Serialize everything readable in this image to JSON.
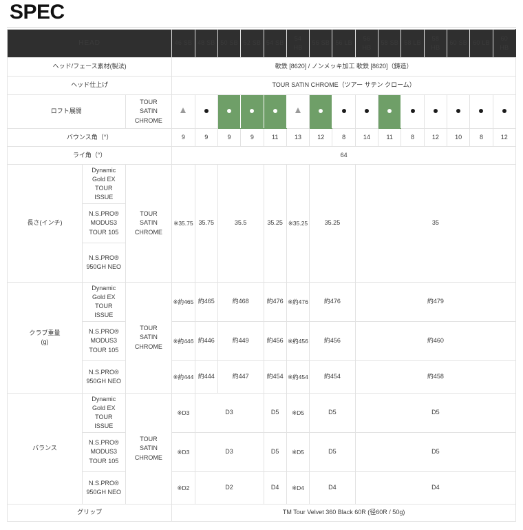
{
  "page": {
    "title": "SPEC"
  },
  "table": {
    "head_label": "HEAD",
    "columns": [
      {
        "line1": "46 SB",
        "line2": ""
      },
      {
        "line1": "48 SB",
        "line2": ""
      },
      {
        "line1": "50 SB",
        "line2": ""
      },
      {
        "line1": "52 SB",
        "line2": ""
      },
      {
        "line1": "54 SB",
        "line2": ""
      },
      {
        "line1": "54",
        "line2": "HB"
      },
      {
        "line1": "56 SB",
        "line2": ""
      },
      {
        "line1": "56 LB",
        "line2": ""
      },
      {
        "line1": "56",
        "line2": "HB"
      },
      {
        "line1": "58 SB",
        "line2": ""
      },
      {
        "line1": "58 LB",
        "line2": ""
      },
      {
        "line1": "58",
        "line2": "HB"
      },
      {
        "line1": "60 SB",
        "line2": ""
      },
      {
        "line1": "60 LB",
        "line2": ""
      },
      {
        "line1": "60",
        "line2": "HB"
      }
    ],
    "rows": {
      "material": {
        "label": "ヘッド/フェース素材(製法)",
        "value": "軟鉄 [8620] / ノンメッキ加工 軟鉄 [8620]（鋳造）"
      },
      "finish": {
        "label": "ヘッド仕上げ",
        "value": "TOUR SATIN CHROME（ツアー サテン クローム）"
      },
      "loft": {
        "label": "ロフト展開",
        "finish": "TOUR SATIN CHROME",
        "markers": [
          "triangle",
          "dot",
          "dot-green",
          "dot-green",
          "dot-green",
          "triangle",
          "dot-green",
          "dot",
          "dot",
          "dot-green",
          "dot",
          "dot",
          "dot",
          "dot",
          "dot"
        ]
      },
      "bounce": {
        "label": "バウンス角（°）",
        "values": [
          "9",
          "9",
          "9",
          "9",
          "11",
          "13",
          "12",
          "8",
          "14",
          "11",
          "8",
          "12",
          "10",
          "8",
          "12"
        ]
      },
      "lie": {
        "label": "ライ角（°）",
        "value": "64"
      },
      "length": {
        "label": "長さ(インチ)",
        "finish": "TOUR SATIN CHROME",
        "shafts": [
          "Dynamic Gold EX TOUR ISSUE",
          "N.S.PRO® MODUS3 TOUR 105",
          "N.S.PRO® 950GH NEO"
        ],
        "cells": [
          {
            "text": "※35.75",
            "span": 1
          },
          {
            "text": "35.75",
            "span": 1
          },
          {
            "text": "35.5",
            "span": 2
          },
          {
            "text": "35.25",
            "span": 1
          },
          {
            "text": "※35.25",
            "span": 1
          },
          {
            "text": "35.25",
            "span": 2
          },
          {
            "text": "35",
            "span": 7
          }
        ]
      },
      "weight": {
        "label": "クラブ重量(g)",
        "label_line1": "クラブ重量",
        "label_line2": "(g)",
        "finish": "TOUR SATIN CHROME",
        "shafts": [
          "Dynamic Gold EX TOUR ISSUE",
          "N.S.PRO® MODUS3 TOUR 105",
          "N.S.PRO® 950GH NEO"
        ],
        "rows": [
          [
            {
              "text": "※約465",
              "span": 1
            },
            {
              "text": "約465",
              "span": 1
            },
            {
              "text": "約468",
              "span": 2
            },
            {
              "text": "約476",
              "span": 1
            },
            {
              "text": "※約476",
              "span": 1
            },
            {
              "text": "約476",
              "span": 2
            },
            {
              "text": "約479",
              "span": 7
            }
          ],
          [
            {
              "text": "※約446",
              "span": 1
            },
            {
              "text": "約446",
              "span": 1
            },
            {
              "text": "約449",
              "span": 2
            },
            {
              "text": "約456",
              "span": 1
            },
            {
              "text": "※約456",
              "span": 1
            },
            {
              "text": "約456",
              "span": 2
            },
            {
              "text": "約460",
              "span": 7
            }
          ],
          [
            {
              "text": "※約444",
              "span": 1
            },
            {
              "text": "約444",
              "span": 1
            },
            {
              "text": "約447",
              "span": 2
            },
            {
              "text": "約454",
              "span": 1
            },
            {
              "text": "※約454",
              "span": 1
            },
            {
              "text": "約454",
              "span": 2
            },
            {
              "text": "約458",
              "span": 7
            }
          ]
        ]
      },
      "balance": {
        "label": "バランス",
        "finish": "TOUR SATIN CHROME",
        "shafts": [
          "Dynamic Gold EX TOUR ISSUE",
          "N.S.PRO® MODUS3 TOUR 105",
          "N.S.PRO® 950GH NEO"
        ],
        "rows": [
          [
            {
              "text": "※D3",
              "span": 1
            },
            {
              "text": "D3",
              "span": 3
            },
            {
              "text": "D5",
              "span": 1
            },
            {
              "text": "※D5",
              "span": 1
            },
            {
              "text": "D5",
              "span": 2
            },
            {
              "text": "D5",
              "span": 7
            }
          ],
          [
            {
              "text": "※D3",
              "span": 1
            },
            {
              "text": "D3",
              "span": 3
            },
            {
              "text": "D5",
              "span": 1
            },
            {
              "text": "※D5",
              "span": 1
            },
            {
              "text": "D5",
              "span": 2
            },
            {
              "text": "D5",
              "span": 7
            }
          ],
          [
            {
              "text": "※D2",
              "span": 1
            },
            {
              "text": "D2",
              "span": 3
            },
            {
              "text": "D4",
              "span": 1
            },
            {
              "text": "※D4",
              "span": 1
            },
            {
              "text": "D4",
              "span": 2
            },
            {
              "text": "D4",
              "span": 7
            }
          ]
        ]
      },
      "grip": {
        "label": "グリップ",
        "value": "TM Tour Velvet 360 Black 60R (径60R / 50g)"
      }
    }
  }
}
